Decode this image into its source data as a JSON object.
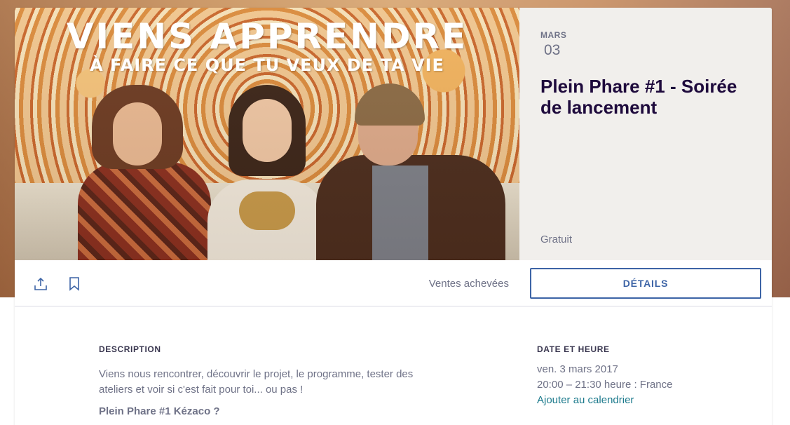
{
  "hero": {
    "title": "VIENS APPRENDRE",
    "subtitle": "À FAIRE CE QUE TU VEUX DE TA VIE"
  },
  "event": {
    "month": "MARS",
    "day": "03",
    "title": "Plein Phare #1 - Soirée de lancement",
    "price": "Gratuit"
  },
  "actions": {
    "share_icon": "share-icon",
    "bookmark_icon": "bookmark-icon",
    "sales_status": "Ventes achevées",
    "details_label": "DÉTAILS"
  },
  "description": {
    "heading": "DESCRIPTION",
    "text": "Viens nous rencontrer, découvrir le projet, le programme, tester des ateliers et voir si c'est fait pour toi... ou pas !",
    "subheading": "Plein Phare #1 Kézaco ?"
  },
  "date_time": {
    "heading": "DATE ET HEURE",
    "date": "ven. 3 mars 2017",
    "time": "20:00 – 21:30 heure : France",
    "calendar_link": "Ajouter au calendrier"
  },
  "colors": {
    "accent": "#3d64a6",
    "link": "#1c7a8c",
    "title": "#1e0a3c",
    "muted": "#6f7287"
  }
}
